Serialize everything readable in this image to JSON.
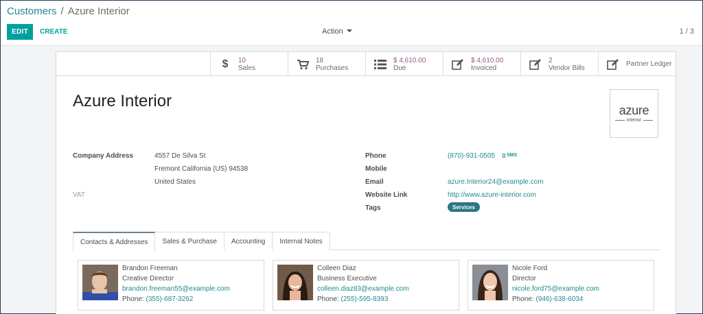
{
  "breadcrumb": {
    "parent": "Customers",
    "separator": "/",
    "current": "Azure Interior"
  },
  "toolbar": {
    "edit_label": "EDIT",
    "create_label": "CREATE",
    "action_label": "Action",
    "pager": "1 / 3"
  },
  "stat_buttons": [
    {
      "icon": "dollar-icon",
      "value": "10",
      "label": "Sales"
    },
    {
      "icon": "cart-icon",
      "value": "18",
      "label": "Purchases"
    },
    {
      "icon": "list-icon",
      "value": "$ 4,610.00",
      "label": "Due"
    },
    {
      "icon": "edit-icon",
      "value": "$ 4,610.00",
      "label": "Invoiced"
    },
    {
      "icon": "edit-icon",
      "value": "2",
      "label": "Vendor Bills"
    },
    {
      "icon": "edit-icon",
      "value": "",
      "label": "Partner Ledger"
    }
  ],
  "partner": {
    "name": "Azure Interior",
    "logo_main": "azure",
    "logo_sub": "interior",
    "address_label": "Company Address",
    "street": "4557 De Silva St",
    "city_line": "Fremont  California (US)  94538",
    "country": "United States",
    "vat_label": "VAT",
    "phone_label": "Phone",
    "phone": "(870)-931-0505",
    "sms_label": "SMS",
    "mobile_label": "Mobile",
    "email_label": "Email",
    "email": "azure.Interior24@example.com",
    "website_label": "Website Link",
    "website": "http://www.azure-interior.com",
    "tags_label": "Tags",
    "tag": "Services"
  },
  "tabs": [
    {
      "label": "Contacts & Addresses",
      "active": true
    },
    {
      "label": "Sales & Purchase",
      "active": false
    },
    {
      "label": "Accounting",
      "active": false
    },
    {
      "label": "Internal Notes",
      "active": false
    }
  ],
  "contacts": [
    {
      "name": "Brandon Freeman",
      "title": "Creative Director",
      "email": "brandon.freeman55@example.com",
      "phone_label": "Phone:",
      "phone": "(355)-687-3262"
    },
    {
      "name": "Colleen Diaz",
      "title": "Business Executive",
      "email": "colleen.diaz83@example.com",
      "phone_label": "Phone:",
      "phone": "(255)-595-8393"
    },
    {
      "name": "Nicole Ford",
      "title": "Director",
      "email": "nicole.ford75@example.com",
      "phone_label": "Phone:",
      "phone": "(946)-638-6034"
    }
  ],
  "colors": {
    "primary": "#00a09d",
    "link": "#1f8a8e",
    "stat_value": "#8f5783",
    "tag": "#2c7585"
  }
}
